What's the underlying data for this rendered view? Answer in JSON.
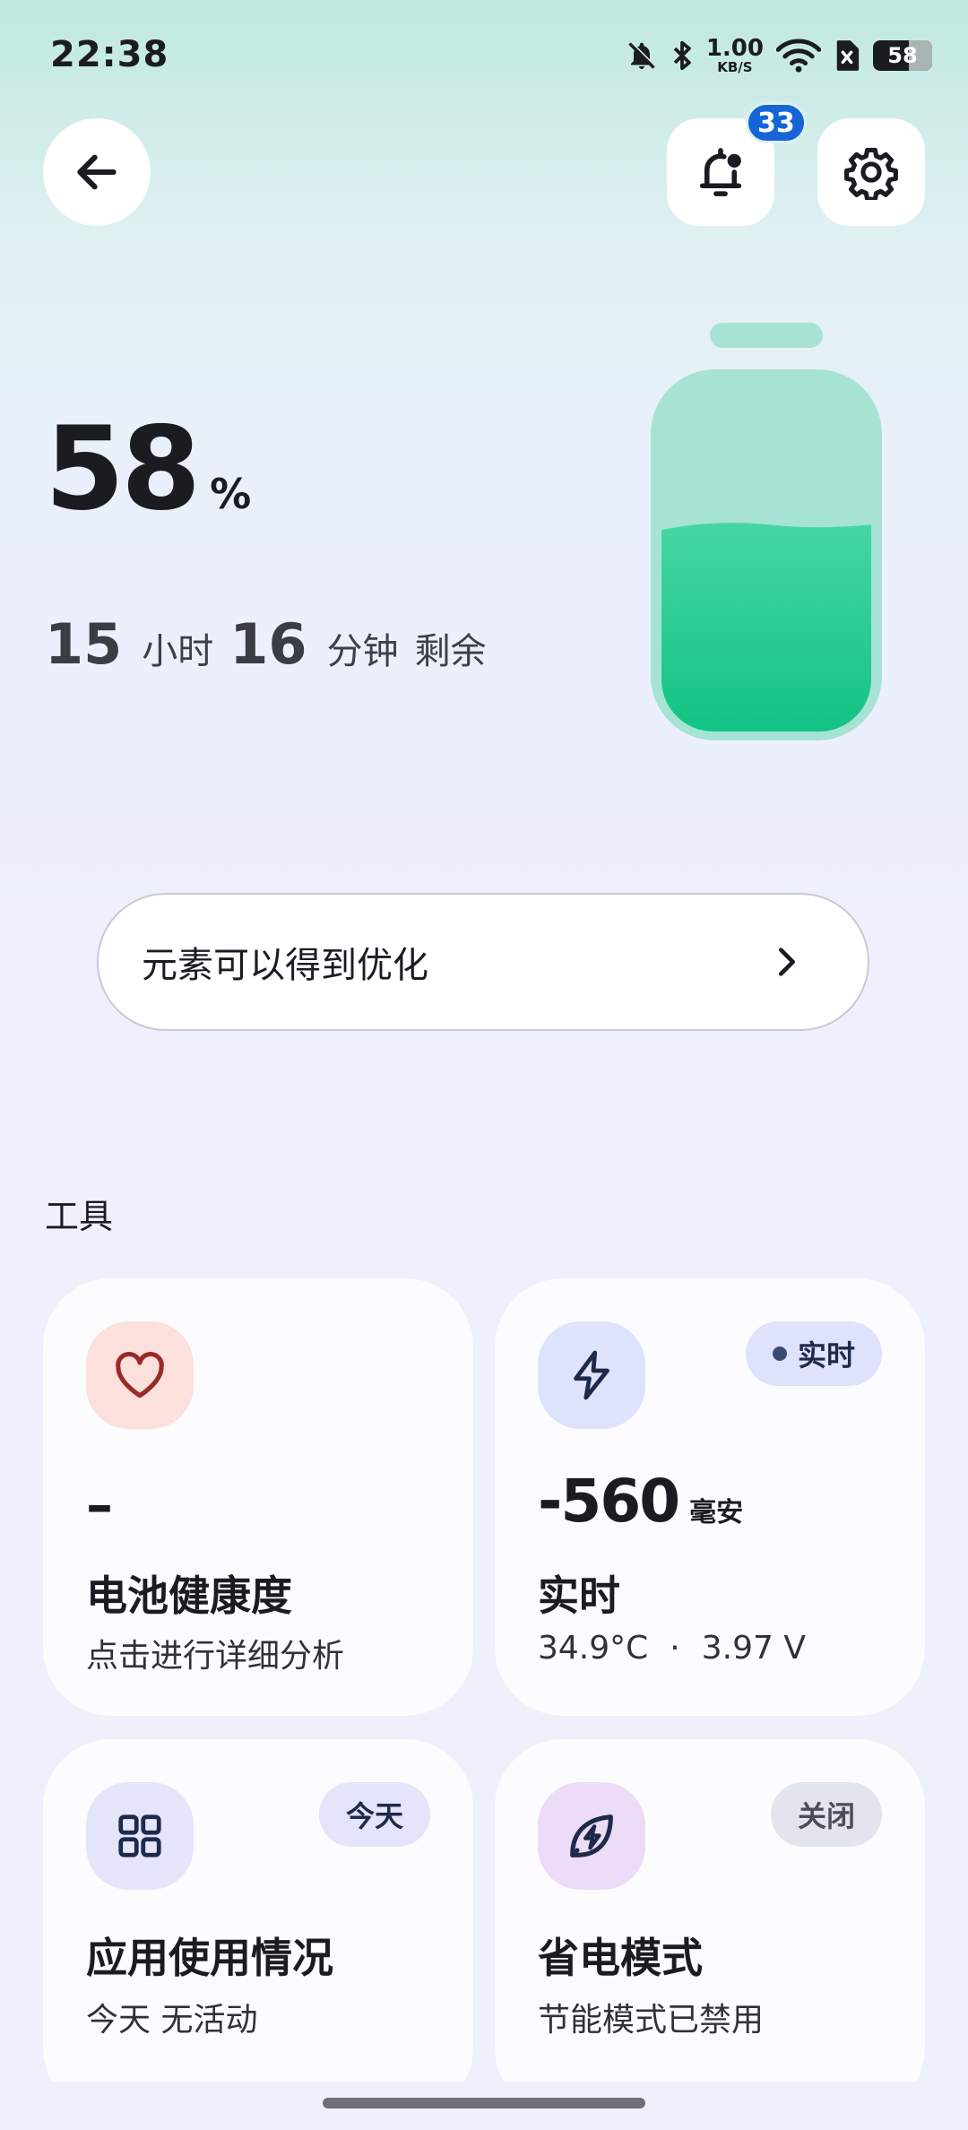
{
  "status_bar": {
    "time": "22:38",
    "net_speed_value": "1.00",
    "net_speed_unit": "KB/S",
    "battery_level": "58",
    "icons": [
      "bell-off-icon",
      "bluetooth-icon",
      "wifi-icon",
      "sim-off-icon",
      "battery-icon"
    ]
  },
  "header": {
    "back_icon": "arrow-left-icon",
    "notifications_icon": "bell-alert-icon",
    "notification_count": "33",
    "settings_icon": "gear-icon"
  },
  "battery": {
    "percent": "58",
    "percent_unit": "%",
    "level_fraction": 0.58,
    "hours": "15",
    "hours_unit": "小时",
    "minutes": "16",
    "minutes_unit": "分钟",
    "remaining_label": "剩余"
  },
  "optimize_banner": {
    "label": "元素可以得到优化",
    "icon": "chevron-right-icon"
  },
  "tools": {
    "section_title": "工具",
    "battery_health": {
      "icon": "heart-icon",
      "value": "–",
      "title": "电池健康度",
      "subtitle": "点击进行详细分析"
    },
    "realtime": {
      "icon": "lightning-icon",
      "pill": "实时",
      "value": "-560",
      "unit": "毫安",
      "title": "实时",
      "temperature": "34.9°C",
      "separator": "·",
      "voltage": "3.97 V"
    },
    "app_usage": {
      "icon": "apps-grid-icon",
      "pill": "今天",
      "title": "应用使用情况",
      "subtitle": "今天 无活动"
    },
    "power_saving": {
      "icon": "leaf-bolt-icon",
      "pill": "关闭",
      "title": "省电模式",
      "subtitle": "节能模式已禁用"
    }
  },
  "colors": {
    "battery_fill": "#1fc98d",
    "battery_shell": "#a6e3d5",
    "badge": "#1565d8",
    "heart_bg": "#fbe0dc",
    "heart": "#9a2a26",
    "bolt_bg": "#dee3fb",
    "grid_bg": "#e4e4fb",
    "leaf_bg": "#ecdcf7"
  }
}
